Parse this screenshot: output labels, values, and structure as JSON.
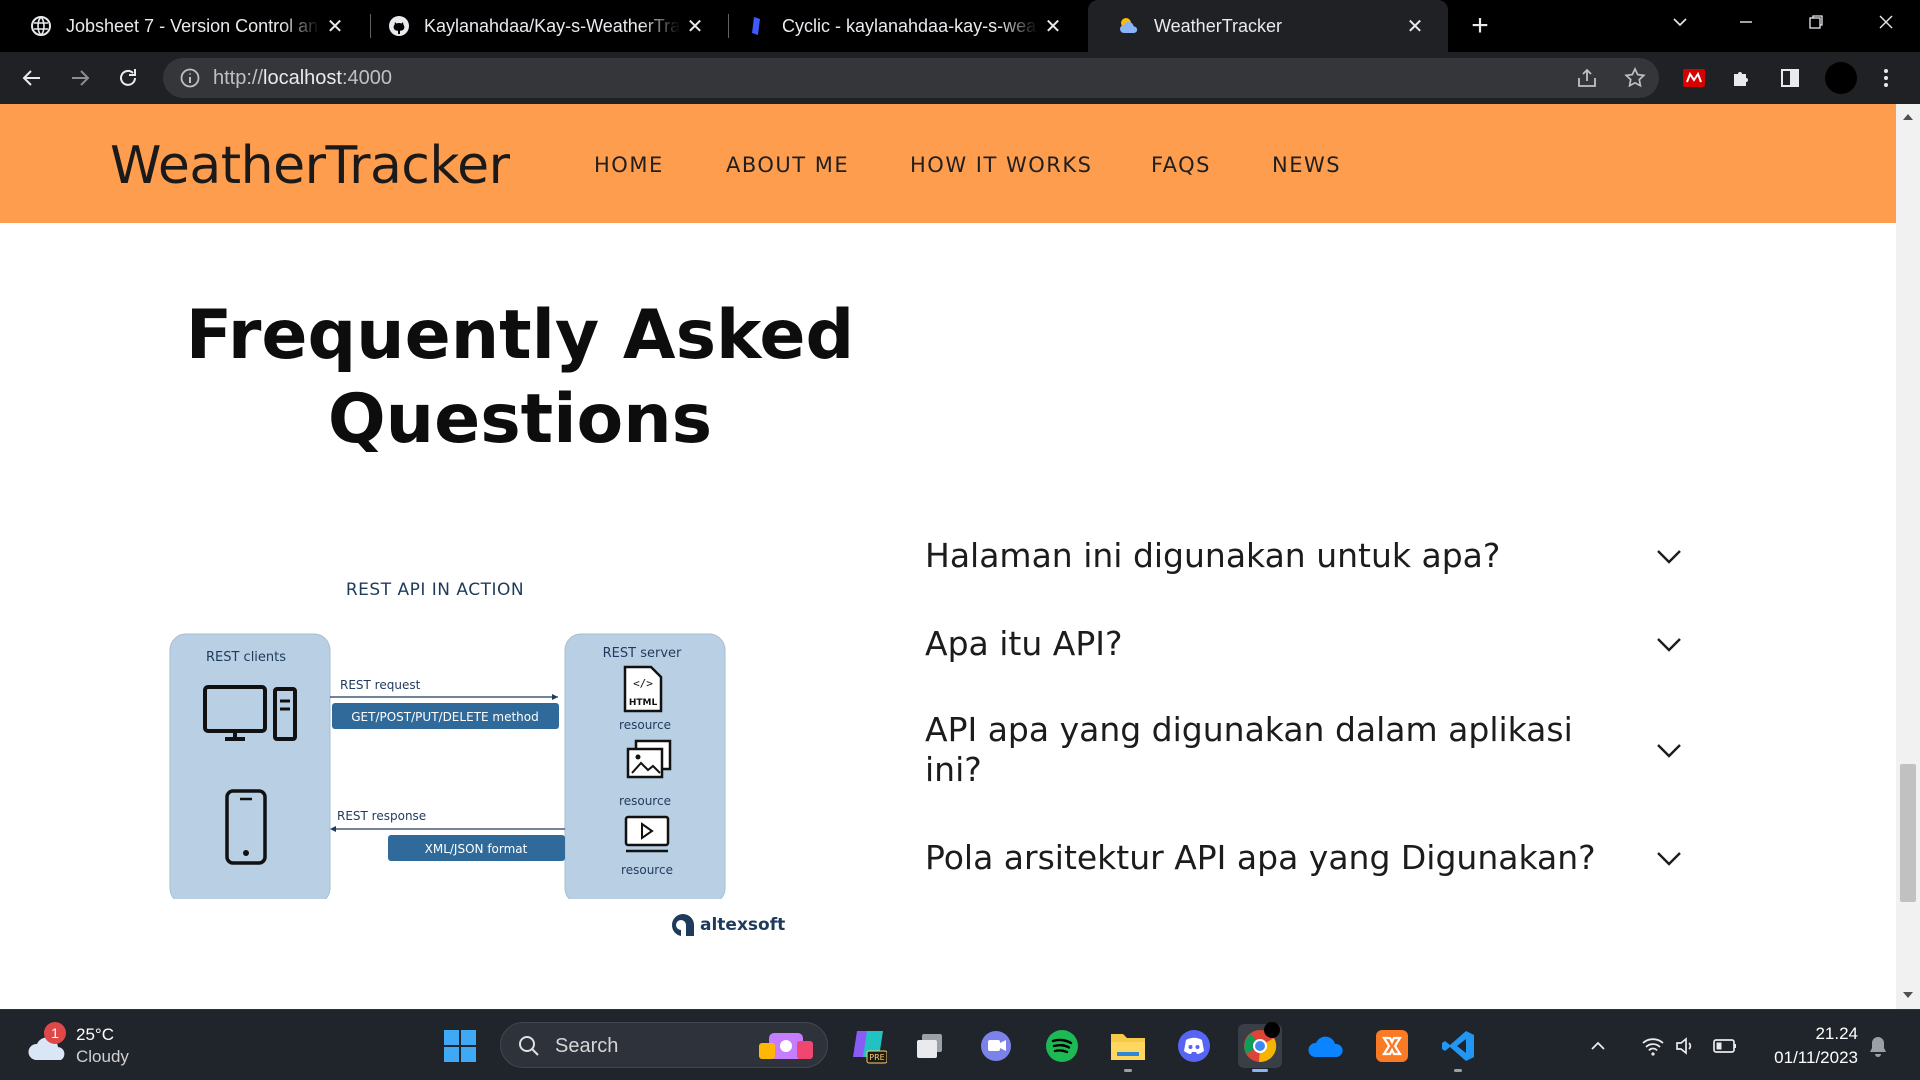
{
  "browser": {
    "tabs": [
      {
        "title": "Jobsheet 7 - Version Control and",
        "active": false
      },
      {
        "title": "Kaylanahdaa/Kay-s-WeatherTrac",
        "active": false
      },
      {
        "title": "Cyclic - kaylanahdaa-kay-s-weat",
        "active": false
      },
      {
        "title": "WeatherTracker",
        "active": true
      }
    ],
    "url_scheme": "http://",
    "url_host": "localhost",
    "url_port": ":4000"
  },
  "site": {
    "brand": "WeatherTracker",
    "nav": [
      "HOME",
      "ABOUT ME",
      "HOW IT WORKS",
      "FAQS",
      "NEWS"
    ],
    "header_color": "#ff9d4e"
  },
  "faq": {
    "title_line1": "Frequently Asked",
    "title_line2": "Questions",
    "questions": [
      "Halaman ini digunakan untuk apa?",
      "Apa itu API?",
      "API apa yang digunakan dalam aplikasi ini?",
      "Pola arsitektur API apa yang Digunakan?"
    ]
  },
  "diagram": {
    "title": "REST API IN ACTION",
    "clients_label": "REST clients",
    "server_label": "REST server",
    "request_label": "REST request",
    "request_methods": "GET/POST/PUT/DELETE method",
    "response_label": "REST response",
    "response_format": "XML/JSON format",
    "resource_label": "resource",
    "html_label": "HTML",
    "logo_text": "altexsoft"
  },
  "taskbar": {
    "weather_temp": "25°C",
    "weather_cond": "Cloudy",
    "weather_badge": "1",
    "search_label": "Search",
    "time": "21.24",
    "date": "01/11/2023"
  }
}
